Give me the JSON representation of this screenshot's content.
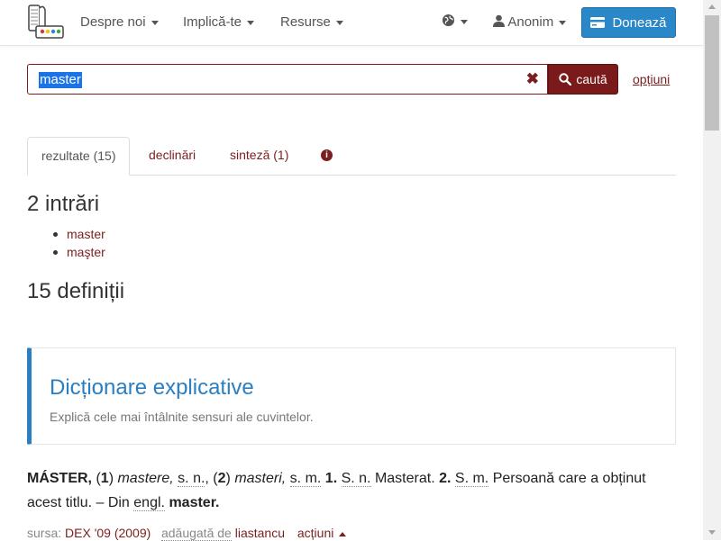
{
  "nav": {
    "about": "Despre noi",
    "involve": "Implică-te",
    "resources": "Resurse",
    "user": "Anonim",
    "donate": "Donează"
  },
  "search": {
    "value": "master",
    "button_label": "caută",
    "options_label": "opțiuni"
  },
  "tabs": [
    {
      "label": "rezultate (15)",
      "active": true
    },
    {
      "label": "declinări",
      "active": false
    },
    {
      "label": "sinteză (1)",
      "active": false
    }
  ],
  "entries": {
    "heading": "2 intrări",
    "items": [
      "master",
      "maşter"
    ]
  },
  "definitions_heading": "15 definiții",
  "panel": {
    "title": "Dicționare explicative",
    "subtitle": "Explică cele mai întâlnite sensuri ale cuvintelor."
  },
  "definition": {
    "headword": "MÁSTER,",
    "n1": "1",
    "form1": "mastere,",
    "gram1": "s. n.",
    "n2": "2",
    "form2": "masteri,",
    "gram2": "s. m.",
    "s1": "1.",
    "gram3": "S. n.",
    "text1": "Masterat.",
    "s2": "2.",
    "gram4": "S. m.",
    "text2": "Persoană care a obținut acest titlu. – Din",
    "engl": "engl.",
    "etym": "master."
  },
  "meta": {
    "source_label": "sursa:",
    "source": "DEX '09 (2009)",
    "added_label": "adăugată de",
    "author": "liastancu",
    "actions": "acțiuni"
  },
  "colors": {
    "brand": "#7b1e1e",
    "accent": "#2a87c8",
    "panel_accent": "#2a7fc2"
  }
}
